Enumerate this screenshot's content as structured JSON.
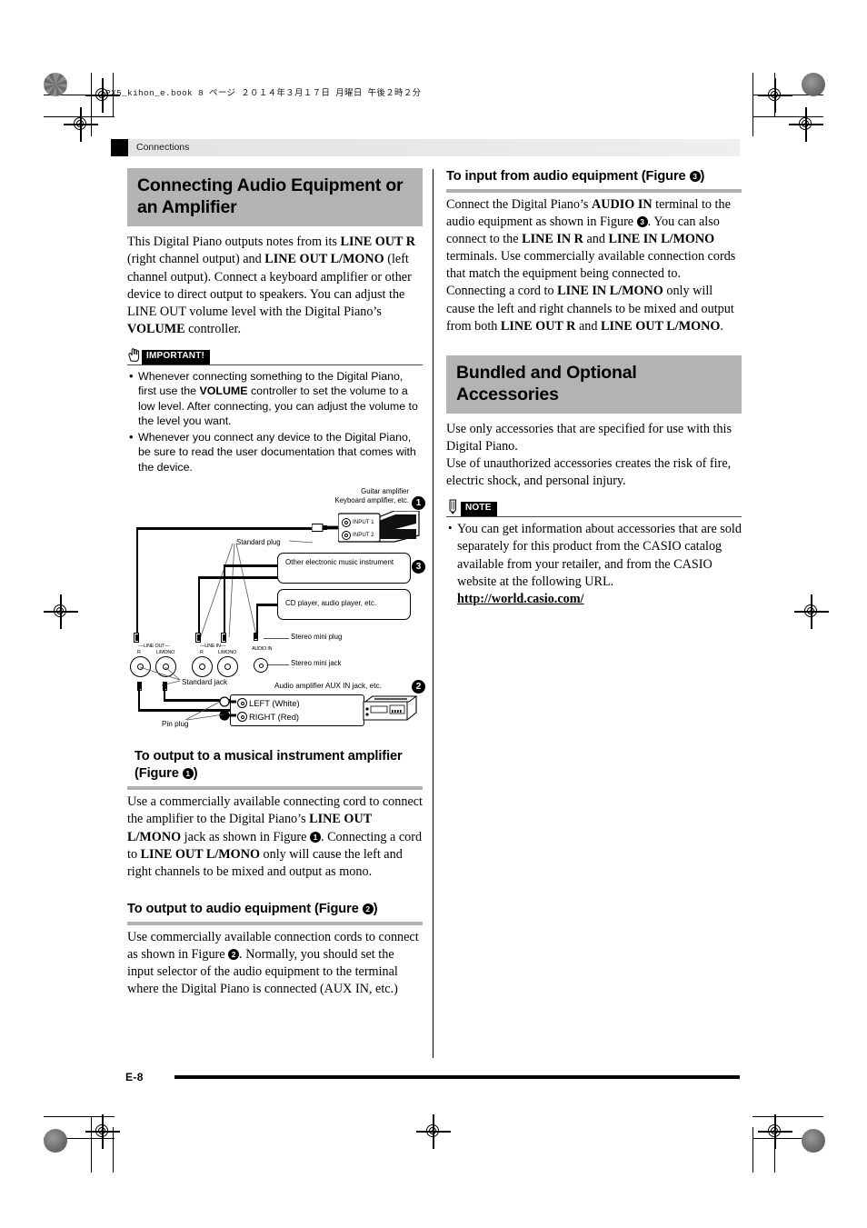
{
  "print_header": {
    "book_info": "PX5_kihon_e.book   8 ページ   ２０１４年３月１７日   月曜日   午後２時２分"
  },
  "running_head": {
    "chapter": "Connections"
  },
  "left_column": {
    "title": "Connecting Audio Equipment or an Amplifier",
    "intro_html": "This Digital Piano outputs notes from its <b>LINE OUT R</b> (right channel output) and <b>LINE OUT L/MONO</b> (left channel output). Connect a keyboard amplifier or other device to direct output to speakers. You can adjust the LINE OUT volume level with the Digital Piano’s <b>VOLUME</b> controller.",
    "important": {
      "label": "IMPORTANT!",
      "icon": "hand-pointing-icon",
      "items_html": [
        "Whenever connecting something to the Digital Piano, first use the <b>VOLUME</b> controller to set the volume to a low level. After connecting, you can adjust the volume to the level you want.",
        "Whenever you connect any device to the Digital Piano, be sure to read the user documentation that comes with the device."
      ]
    },
    "section1": {
      "heading_html": "To output to a musical instrument amplifier (Figure <span class=\"badge\">1</span>)",
      "body_html": "Use a commercially available connecting cord to connect the amplifier to the Digital Piano’s <b>LINE OUT L/MONO</b> jack as shown in Figure <span class=\"badge\">1</span>. Connecting a cord to <b>LINE OUT L/MONO</b> only will cause the left and right channels to be mixed and output as mono."
    },
    "section2": {
      "heading_html": "To output to audio equipment (Figure <span class=\"badge\">2</span>)",
      "body_html": "Use commercially available connection cords to connect as shown in Figure <span class=\"badge\">2</span>. Normally, you should set the input selector of the audio equipment to the terminal where the Digital Piano is connected (AUX IN, etc.)"
    }
  },
  "diagram": {
    "labels": {
      "guitar_amp_line1": "Guitar amplifier",
      "guitar_amp_line2": "Keyboard amplifier, etc.",
      "input1": "INPUT 1",
      "input2": "INPUT 2",
      "standard_plug": "Standard plug",
      "other_instrument": "Other electronic music instrument",
      "cd_player": "CD player, audio player, etc.",
      "stereo_mini_plug": "Stereo mini plug",
      "stereo_mini_jack": "Stereo mini jack",
      "standard_jack": "Standard jack",
      "aux_in": "Audio amplifier AUX IN jack, etc.",
      "left_white": "LEFT (White)",
      "right_red": "RIGHT (Red)",
      "pin_plug": "Pin plug",
      "panel_line_out": "LINE OUT",
      "panel_line_in": "LINE IN",
      "panel_r": "R",
      "panel_lmono": "L/MONO",
      "panel_audio_in": "AUDIO IN"
    },
    "badges": [
      "1",
      "2",
      "3"
    ]
  },
  "right_column": {
    "section3": {
      "heading_html": "To input from audio equipment (Figure <span class=\"badge\">3</span>)",
      "body_html": "Connect the Digital Piano’s <b>AUDIO IN</b> terminal to the audio equipment as shown in Figure <span class=\"badge\">3</span>. You can also connect to the <b>LINE IN R</b> and <b>LINE IN L/MONO</b> terminals. Use commercially available connection cords that match the equipment being connected to. Connecting a cord to <b>LINE IN L/MONO</b> only will cause the left and right channels to be mixed and output from both <b>LINE OUT R</b> and <b>LINE OUT L/MONO</b>."
    },
    "title": "Bundled and Optional Accessories",
    "intro_html": "Use only accessories that are specified for use with this Digital Piano.<br>Use of unauthorized accessories creates the risk of fire, electric shock, and personal injury.",
    "note": {
      "label": "NOTE",
      "icon": "pencil-icon",
      "items_html": [
        "You can get information about accessories that are sold separately for this product from the CASIO catalog available from your retailer, and from the CASIO website at the following URL.<br><span class=\"urllink\">http://world.casio.com/</span>"
      ]
    }
  },
  "footer": {
    "page_number": "E-8"
  },
  "colors": {
    "title_band": "#b3b3b3",
    "running_head": "#e6e6e6",
    "sub_rule": "#b0b0b0",
    "ink": "#000000"
  }
}
